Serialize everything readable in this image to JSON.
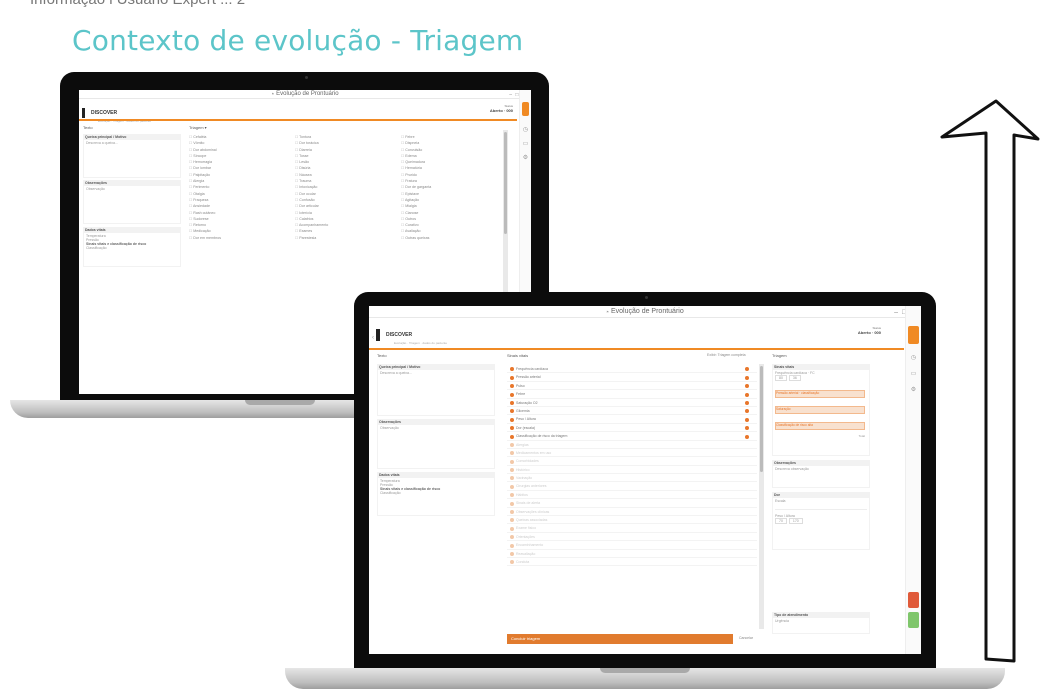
{
  "top_cut_text": "Informação l Úsuário Expert ... 2",
  "title": "Contexto de evolução - Triagem",
  "app": {
    "title": "Evolução de Prontuário",
    "patient_name": "DISCOVER",
    "patient_sub": "Evolução · Triagem · dados do paciente",
    "status_label": "Status",
    "status_value": "Aberto · 000"
  },
  "upper": {
    "left_header": "Texto",
    "right_header": "Triagem ▾",
    "section1": {
      "title": "Queixa principal / Motivo",
      "body": "Descreva a queixa..."
    },
    "section2": {
      "title": "Observações",
      "body": "Observação"
    },
    "section3": {
      "title": "Dados vitais",
      "items": [
        "Temperatura",
        "Pressão"
      ],
      "sub": "Sinais vitais e classificação de risco",
      "value": "Classificação"
    },
    "grid_items": [
      "Cefaléia",
      "Tontura",
      "Febre",
      "Vômito",
      "Dor torácica",
      "Dispneia",
      "Dor abdominal",
      "Diarreia",
      "Convulsão",
      "Síncope",
      "Tosse",
      "Edema",
      "Hemorragia",
      "Lesão",
      "Queimadura",
      "Dor lombar",
      "Disúria",
      "Hematúria",
      "Palpitação",
      "Náusea",
      "Prurido",
      "Alergia",
      "Trauma",
      "Fratura",
      "Ferimento",
      "Intoxicação",
      "Dor de garganta",
      "Otalgia",
      "Dor ocular",
      "Epistaxe",
      "Fraqueza",
      "Confusão",
      "Agitação",
      "Ansiedade",
      "Dor articular",
      "Mialgia",
      "Rash cutâneo",
      "Icterícia",
      "Cianose",
      "Sudorese",
      "Calafrios",
      "Outros",
      "Retorno",
      "Acompanhamento",
      "Curativo",
      "Medicação",
      "Exames",
      "Avaliação",
      "Dor em membros",
      "Parestesia",
      "Outras queixas"
    ]
  },
  "lower": {
    "left_header": "Texto",
    "middle_header": "Sinais vitais",
    "middle_right": "Exibir: Triagem completa",
    "right_header": "Triagem",
    "section1": {
      "title": "Queixa principal / Motivo",
      "body": "Descreva a queixa..."
    },
    "section2": {
      "title": "Observações",
      "body": "Observação"
    },
    "section3": {
      "title": "Dados vitais",
      "items": [
        "Temperatura",
        "Pressão"
      ],
      "sub": "Sinais vitais e classificação de risco",
      "value": "Classificação"
    },
    "list_items": [
      "Frequência cardíaca",
      "Pressão arterial",
      "Pulso",
      "Febre",
      "Saturação O2",
      "Glicemia",
      "Peso / Altura",
      "Dor (escala)",
      "Classificação de risco da triagem",
      "Alergias",
      "Medicamentos em uso",
      "Comorbidades",
      "Histórico",
      "Vacinação",
      "Cirurgias anteriores",
      "Hábitos",
      "Sinais de alerta",
      "Observações clínicas",
      "Queixas associadas",
      "Exame físico",
      "Orientações",
      "Encaminhamento",
      "Reavaliação",
      "Conduta"
    ],
    "orange_bar": "Concluir triagem",
    "cancel_button": "Cancelar",
    "rp_section1": {
      "title": "Sinais vitais",
      "sub": "Frequência cardíaca · FC",
      "v1": "80",
      "v2": "36"
    },
    "rp_orange": [
      "Pressão arterial · classificação",
      "Saturação",
      "Classificação de risco alta"
    ],
    "rp_orange_value": "Total",
    "rp_section2": {
      "title": "Observações",
      "body": "Descreva observação"
    },
    "rp_section3": {
      "title": "Dor",
      "body": "Escala",
      "sub": "Peso / Altura",
      "v1": "70",
      "v2": "170"
    },
    "rp_footer": {
      "title": "Tipo de atendimento",
      "value": "Urgência"
    }
  }
}
